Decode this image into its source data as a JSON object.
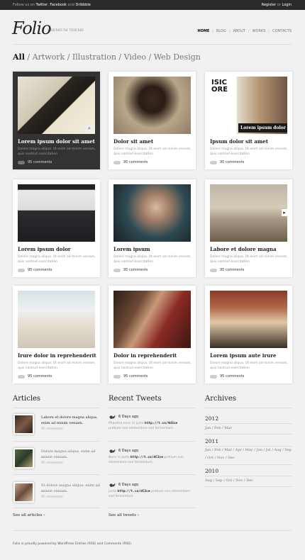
{
  "topbar": {
    "follow_prefix": "Follow us on",
    "twitter": "Twitter",
    "facebook": "Facebook",
    "and": "and",
    "dribbble": "Dribbble",
    "register": "Register",
    "or": "or",
    "login": "Login"
  },
  "header": {
    "logo": "Folio",
    "tagline": "PREMIUM THEME"
  },
  "nav": [
    "HOME",
    "BLOG",
    "ABOUT",
    "WORKS",
    "CONTACTS"
  ],
  "filters": {
    "all": "All",
    "items": [
      "Artwork",
      "Illustration",
      "Video",
      "Web Design"
    ]
  },
  "cards": [
    {
      "title": "Lorem ipsum dolor sit amet",
      "excerpt": "Dolore magna aliqua. Ut enim ad minim veniam, quis nostrud exercitation",
      "comments": "95 comments"
    },
    {
      "title": "Dolor sit amet",
      "excerpt": "Dolore magna aliqua. Ut enim ad minim veniam, quis nostrud exercitation",
      "comments": "95 comments"
    },
    {
      "title": "Ipsum dolor sit amet",
      "excerpt": "Dolore magna aliqua. Ut enim ad minim veniam, quis nostrud exercitation",
      "comments": "95 comments",
      "overlay": "Lorem ipsum dolor s",
      "overlay_top": "ISIC ORE"
    },
    {
      "title": "Lorem ipsum dolor",
      "excerpt": "Dolore magna aliqua. Ut enim ad minim veniam, quis nostrud exercitation",
      "comments": "95 comments"
    },
    {
      "title": "Lorem ipsum",
      "excerpt": "Dolore magna aliqua. Ut enim ad minim veniam, quis nostrud exercitation",
      "comments": "95 comments"
    },
    {
      "title": "Labore et dolore magna",
      "excerpt": "Dolore magna aliqua. Ut enim ad minim veniam, quis nostrud exercitation",
      "comments": "95 comments"
    },
    {
      "title": "Irure dolor in reprehenderit",
      "excerpt": "Dolore magna aliqua. Ut enim ad minim veniam, quis nostrud exercitation",
      "comments": "95 comments"
    },
    {
      "title": "Dolor in reprehenderit",
      "excerpt": "Dolore magna aliqua. Ut enim ad minim veniam, quis nostrud exercitation",
      "comments": "95 comments"
    },
    {
      "title": "Lorem ipsum aute irure",
      "excerpt": "Dolore magna aliqua. Ut enim ad minim veniam, quis nostrud exercitation",
      "comments": "95 comments"
    }
  ],
  "articles": {
    "heading": "Articles",
    "items": [
      {
        "title": "Labore et dolore magna aliqua. enim ad minim veniam.",
        "comments": "95 comments"
      },
      {
        "title": "Dolore magna aliqua. enim ad minim veniam.",
        "comments": "95 comments"
      },
      {
        "title": "Et dolore magna aliqua. enim ad minim veniam.",
        "comments": "95 comments"
      }
    ],
    "see_all": "See all articles"
  },
  "tweets": {
    "heading": "Recent Tweets",
    "items": [
      {
        "time": "6 Days ago",
        "pre": "Pharetra nunc in justo",
        "link": "http://t.co/4d3ce",
        "post": "pretium non elementum sed fermentum."
      },
      {
        "time": "6 Days ago",
        "pre": "Nunc in justo",
        "link": "http://t.co/dC3ce",
        "post": "pretium non elementum sed fermentum."
      },
      {
        "time": "6 Days ago",
        "pre": "Justo",
        "link": "http://t.co/dC3ce",
        "post": "pretium non elementum sed fermentum."
      }
    ],
    "see_all": "See all tweets"
  },
  "archives": {
    "heading": "Archives",
    "years": [
      {
        "year": "2012",
        "months": "Jan / Feb / Mar"
      },
      {
        "year": "2011",
        "months": "Jan / Feb / Mar / Apr / May / Jun / Jul / Aug / Sep / Oct / Nov / Dec"
      },
      {
        "year": "2010",
        "months": "Aug / Sep / Oct / Nov / Dec"
      }
    ]
  },
  "footer": "Folio is proudly powered by WordPress  Entries (RSS) and Comments (RSS)"
}
